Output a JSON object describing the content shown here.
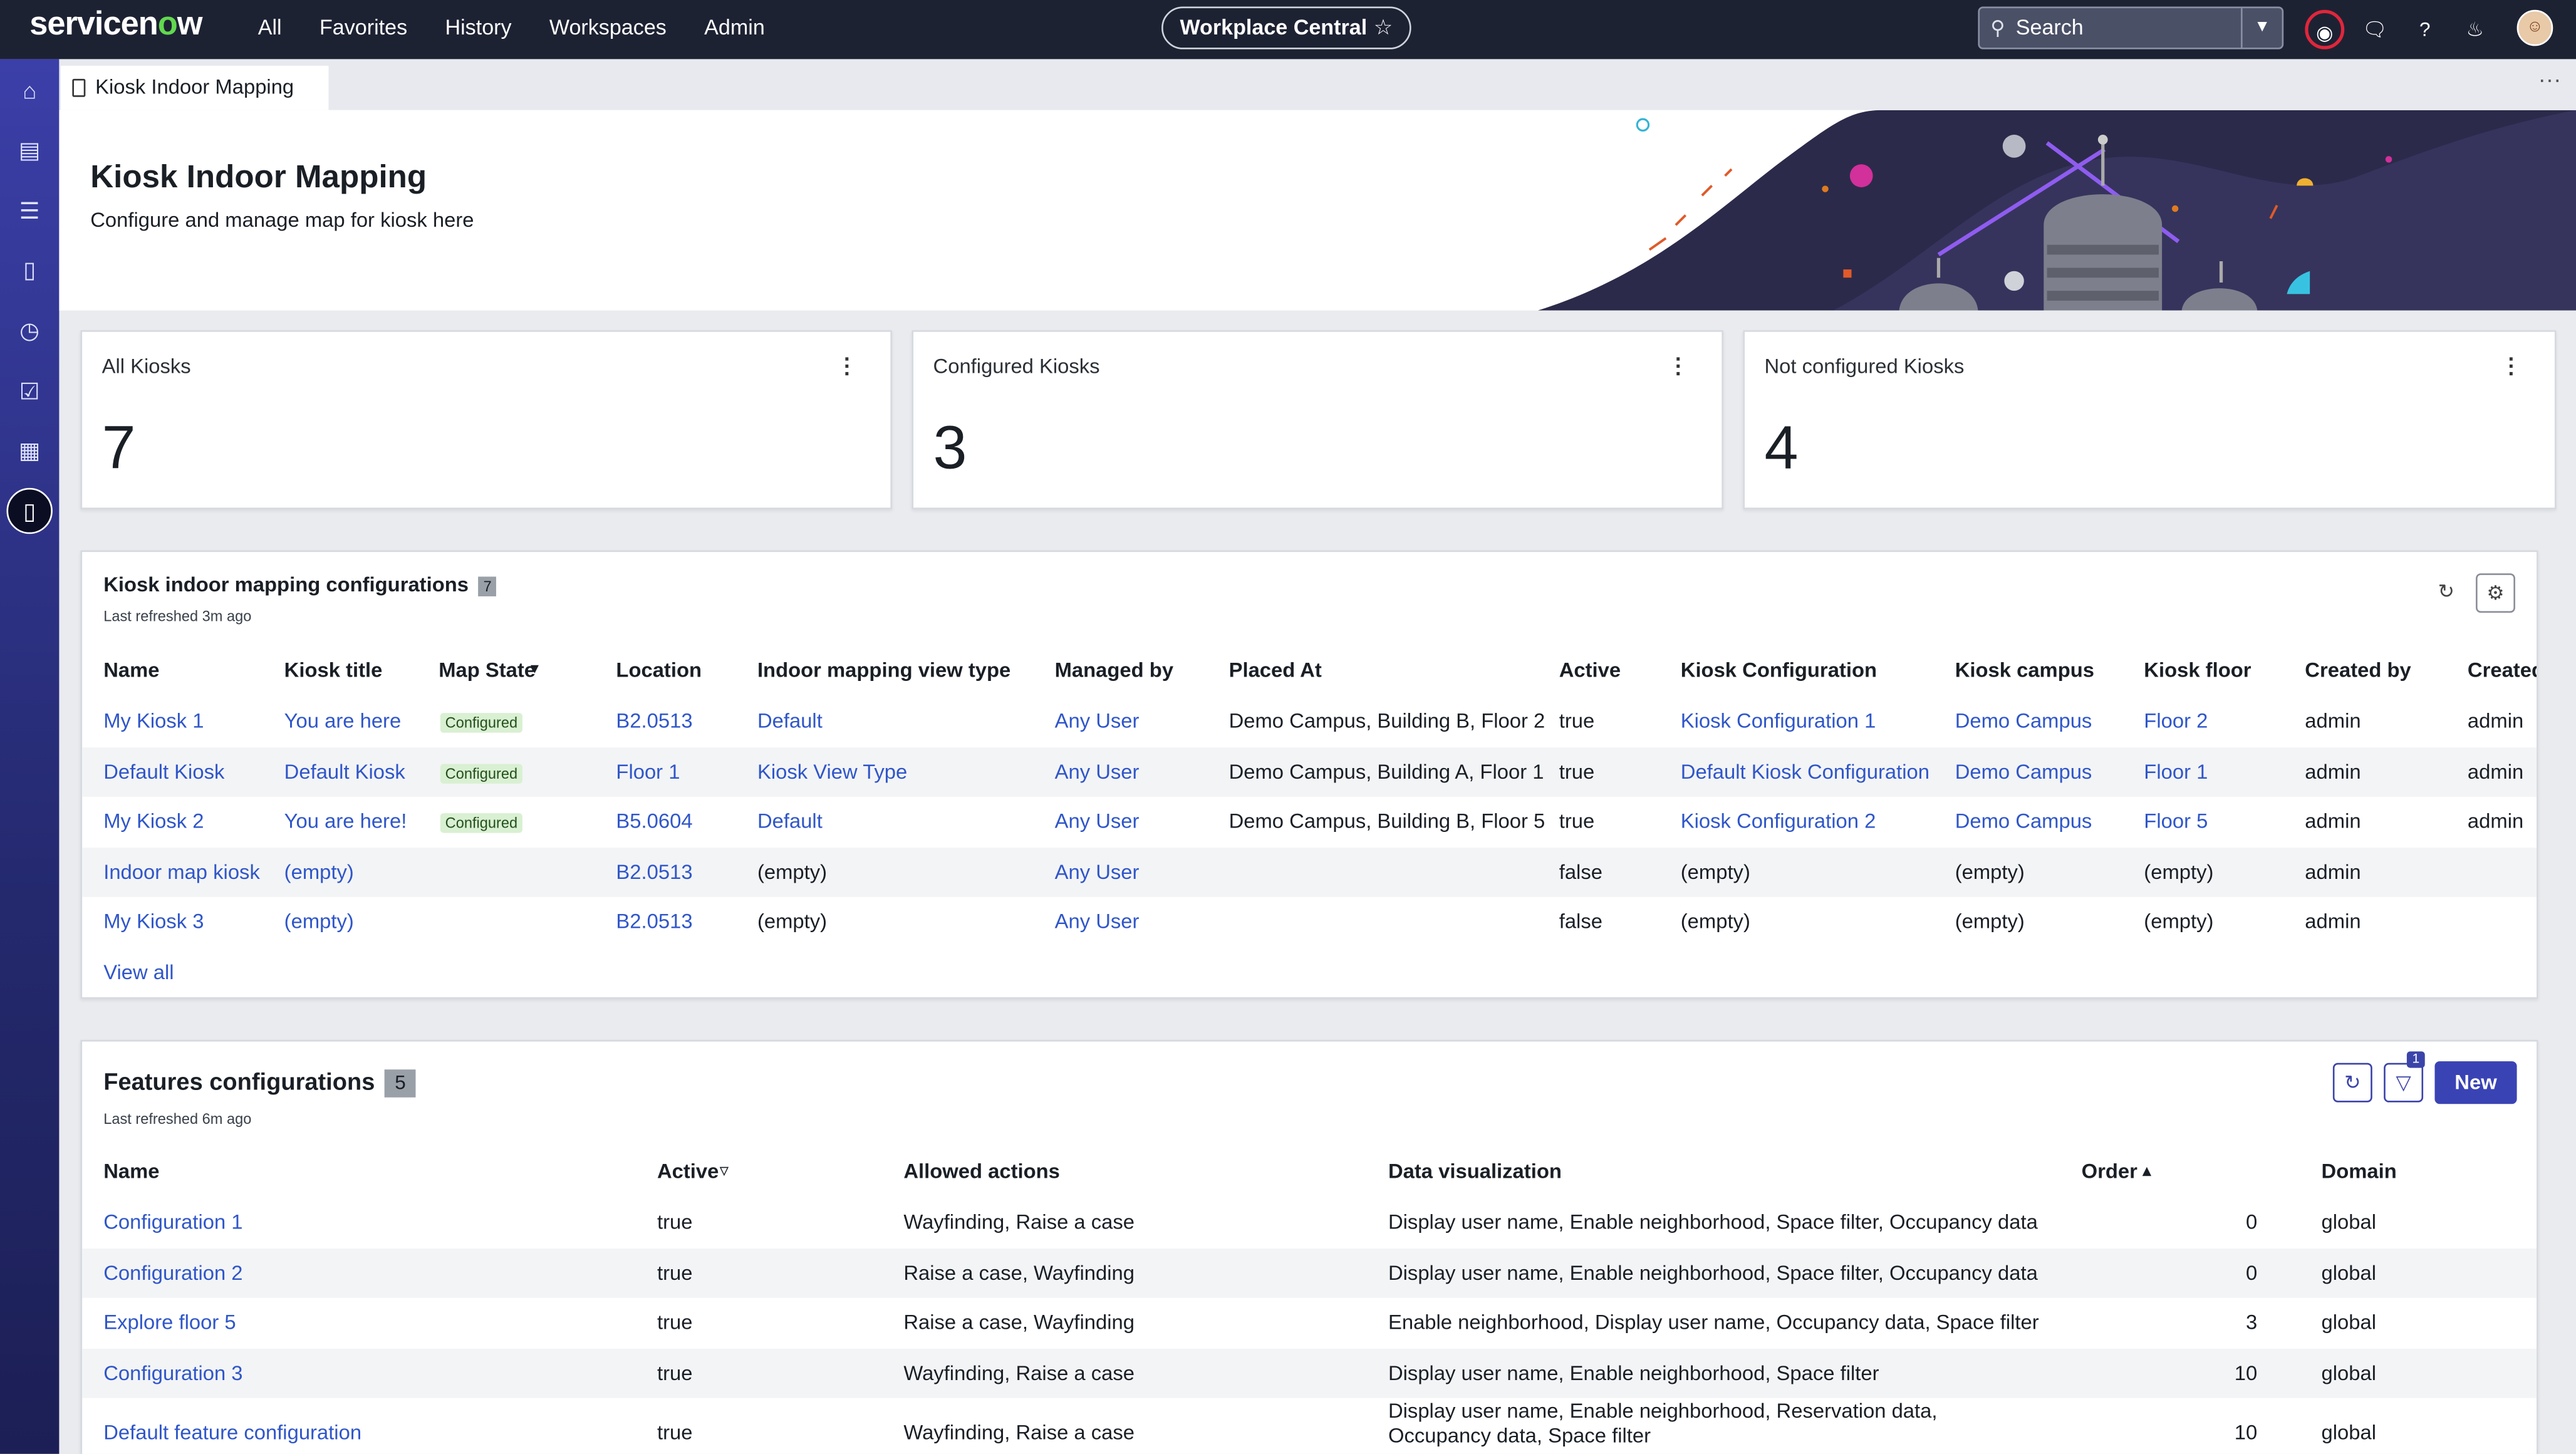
{
  "app": {
    "brand": "servicenow",
    "nav": [
      "All",
      "Favorites",
      "History",
      "Workspaces",
      "Admin"
    ],
    "workspace": "Workplace Central",
    "search_placeholder": "Search"
  },
  "tab": {
    "label": "Kiosk Indoor Mapping"
  },
  "header": {
    "title": "Kiosk Indoor Mapping",
    "subtitle": "Configure and manage map for kiosk here"
  },
  "cards": [
    {
      "title": "All Kiosks",
      "value": "7"
    },
    {
      "title": "Configured Kiosks",
      "value": "3"
    },
    {
      "title": "Not configured Kiosks",
      "value": "4"
    }
  ],
  "kiosk_table": {
    "title": "Kiosk indoor mapping configurations",
    "count": "7",
    "refreshed": "Last refreshed 3m ago",
    "columns": [
      "Name",
      "Kiosk title",
      "Map State",
      "Location",
      "Indoor mapping view type",
      "Managed by",
      "Placed At",
      "Active",
      "Kiosk Configuration",
      "Kiosk campus",
      "Kiosk floor",
      "Created by",
      "Created"
    ],
    "rows": [
      {
        "name": "My Kiosk 1",
        "title": "You are here",
        "map_state": "Configured",
        "location": "B2.0513",
        "view_type": "Default",
        "managed_by": "Any User",
        "placed_at": "Demo Campus, Building B, Floor 2",
        "active": "true",
        "config": "Kiosk Configuration 1",
        "campus": "Demo Campus",
        "floor": "Floor 2",
        "created_by": "admin",
        "created": "admin"
      },
      {
        "name": "Default Kiosk",
        "title": "Default Kiosk",
        "map_state": "Configured",
        "location": "Floor 1",
        "view_type": "Kiosk View Type",
        "managed_by": "Any User",
        "placed_at": "Demo Campus, Building A, Floor 1",
        "active": "true",
        "config": "Default Kiosk Configuration",
        "campus": "Demo Campus",
        "floor": "Floor 1",
        "created_by": "admin",
        "created": "admin"
      },
      {
        "name": "My Kiosk 2",
        "title": "You are here!",
        "map_state": "Configured",
        "location": "B5.0604",
        "view_type": "Default",
        "managed_by": "Any User",
        "placed_at": "Demo Campus, Building B, Floor 5",
        "active": "true",
        "config": "Kiosk Configuration 2",
        "campus": "Demo Campus",
        "floor": "Floor 5",
        "created_by": "admin",
        "created": "admin"
      },
      {
        "name": "Indoor map kiosk",
        "title": "(empty)",
        "map_state": "",
        "location": "B2.0513",
        "view_type": "(empty)",
        "managed_by": "Any User",
        "placed_at": "",
        "active": "false",
        "config": "(empty)",
        "campus": "(empty)",
        "floor": "(empty)",
        "created_by": "admin",
        "created": ""
      },
      {
        "name": "My Kiosk 3",
        "title": "(empty)",
        "map_state": "",
        "location": "B2.0513",
        "view_type": "(empty)",
        "managed_by": "Any User",
        "placed_at": "",
        "active": "false",
        "config": "(empty)",
        "campus": "(empty)",
        "floor": "(empty)",
        "created_by": "admin",
        "created": ""
      }
    ],
    "view_all": "View all"
  },
  "features_table": {
    "title": "Features configurations",
    "count": "5",
    "refreshed": "Last refreshed 6m ago",
    "new_label": "New",
    "filter_count": "1",
    "columns": [
      "Name",
      "Active",
      "Allowed actions",
      "Data visualization",
      "Order",
      "Domain"
    ],
    "rows": [
      {
        "name": "Configuration 1",
        "active": "true",
        "actions": "Wayfinding, Raise a case",
        "viz": "Display user name, Enable neighborhood, Space filter, Occupancy data",
        "order": "0",
        "domain": "global"
      },
      {
        "name": "Configuration 2",
        "active": "true",
        "actions": "Raise a case, Wayfinding",
        "viz": "Display user name, Enable neighborhood, Space filter, Occupancy data",
        "order": "0",
        "domain": "global"
      },
      {
        "name": "Explore floor 5",
        "active": "true",
        "actions": "Raise a case, Wayfinding",
        "viz": "Enable neighborhood, Display user name, Occupancy data, Space filter",
        "order": "3",
        "domain": "global"
      },
      {
        "name": "Configuration 3",
        "active": "true",
        "actions": "Wayfinding, Raise a case",
        "viz": "Display user name, Enable neighborhood, Space filter",
        "order": "10",
        "domain": "global"
      },
      {
        "name": "Default feature configuration",
        "active": "true",
        "actions": "Wayfinding, Raise a case",
        "viz": "Display user name, Enable neighborhood, Reservation data, Occupancy data, Space filter",
        "order": "10",
        "domain": "global"
      }
    ]
  },
  "colors": {
    "nav_bg": "#1d2233",
    "rail": "#3b3fa8",
    "link": "#2f56c9",
    "primary": "#3a43b4",
    "configured_badge": "#d9f0d2"
  }
}
